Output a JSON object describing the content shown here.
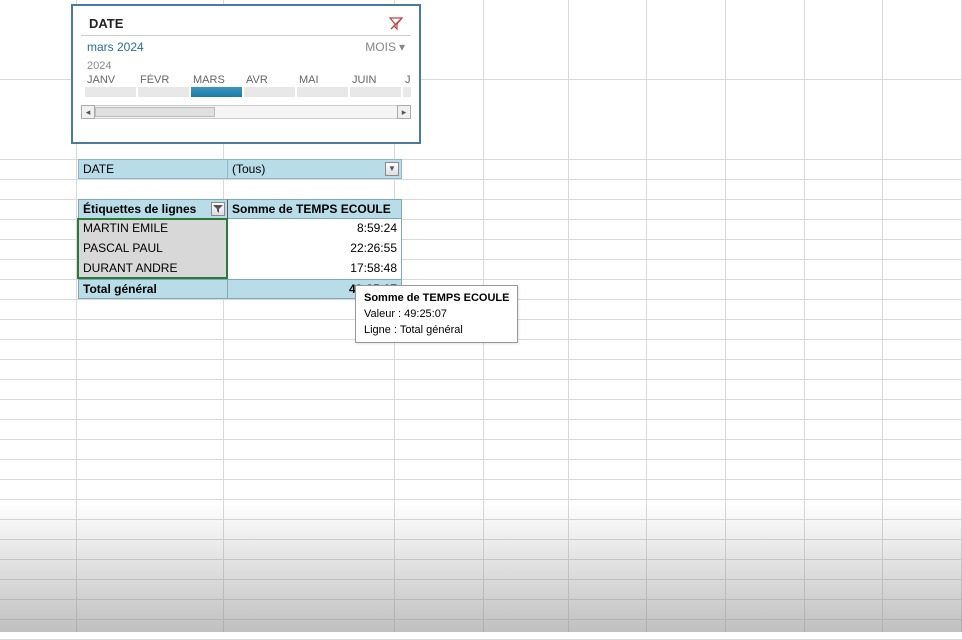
{
  "slicer": {
    "title": "DATE",
    "period": "mars 2024",
    "granularity": "MOIS",
    "year": "2024",
    "months": [
      "JANV",
      "FÉVR",
      "MARS",
      "AVR",
      "MAI",
      "JUIN",
      "J"
    ],
    "selected_idx": 2
  },
  "filter": {
    "label": "DATE",
    "value": "(Tous)"
  },
  "pivot": {
    "col_labels": "Étiquettes de lignes",
    "col_value": "Somme de TEMPS ECOULE",
    "rows": [
      {
        "label": "MARTIN EMILE",
        "value": "8:59:24"
      },
      {
        "label": "PASCAL PAUL",
        "value": "22:26:55"
      },
      {
        "label": "DURANT ANDRE",
        "value": "17:58:48"
      }
    ],
    "total_label": "Total général",
    "total_value": "49:25:07"
  },
  "tooltip": {
    "title": "Somme de TEMPS ECOULE",
    "line1": "Valeur : 49:25:07",
    "line2": "Ligne : Total général"
  }
}
